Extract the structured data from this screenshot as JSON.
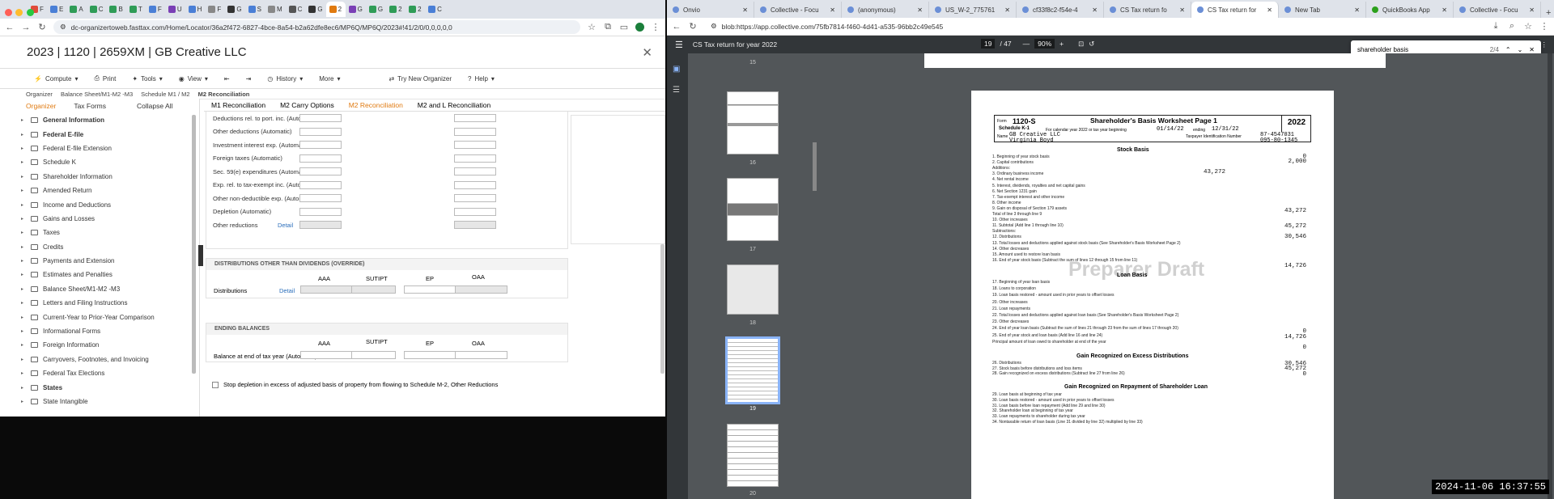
{
  "left_browser": {
    "tabs": [
      {
        "label": "F"
      },
      {
        "label": "E"
      },
      {
        "label": "A"
      },
      {
        "label": "C"
      },
      {
        "label": "B"
      },
      {
        "label": "T"
      },
      {
        "label": "F"
      },
      {
        "label": "U"
      },
      {
        "label": "H"
      },
      {
        "label": "F"
      },
      {
        "label": "G"
      },
      {
        "label": "S"
      },
      {
        "label": "M"
      },
      {
        "label": "C"
      },
      {
        "label": "G"
      },
      {
        "label": "2"
      },
      {
        "label": "G"
      },
      {
        "label": "G"
      },
      {
        "label": "2"
      },
      {
        "label": "2"
      },
      {
        "label": "C"
      }
    ],
    "url": "dc-organizertoweb.fasttax.com/Home/Locator/36a2f472-6827-4bce-8a54-b2a62dfe8ec6/MP6Q/MP6Q/2023#!41/2/0/0,0,0,0,0",
    "app_title": "2023 | 1120 | 2659XM | GB Creative LLC",
    "toolbar": {
      "compute": "Compute",
      "print": "Print",
      "tools": "Tools",
      "view": "View",
      "history": "History",
      "more": "More",
      "try_new": "Try New Organizer",
      "help": "Help"
    },
    "breadcrumbs": [
      "Organizer",
      "Balance Sheet/M1-M2 -M3",
      "Schedule M1 / M2",
      "M2 Reconciliation"
    ],
    "sidebar": {
      "organizer_tab": "Organizer",
      "tax_forms_tab": "Tax Forms",
      "collapse": "Collapse All",
      "items": [
        {
          "label": "General Information",
          "bold": true
        },
        {
          "label": "Federal E-file",
          "bold": true
        },
        {
          "label": "Federal E-file Extension"
        },
        {
          "label": "Schedule K"
        },
        {
          "label": "Shareholder Information"
        },
        {
          "label": "Amended Return"
        },
        {
          "label": "Income and Deductions"
        },
        {
          "label": "Gains and Losses"
        },
        {
          "label": "Taxes"
        },
        {
          "label": "Credits"
        },
        {
          "label": "Payments and Extension"
        },
        {
          "label": "Estimates and Penalties"
        },
        {
          "label": "Balance Sheet/M1-M2 -M3"
        },
        {
          "label": "Letters and Filing Instructions"
        },
        {
          "label": "Current-Year to Prior-Year Comparison"
        },
        {
          "label": "Informational Forms"
        },
        {
          "label": "Foreign Information"
        },
        {
          "label": "Carryovers, Footnotes, and Invoicing"
        },
        {
          "label": "Federal Tax Elections"
        },
        {
          "label": "States",
          "bold": true
        },
        {
          "label": "State Intangible"
        }
      ]
    },
    "form_tabs": [
      "M1 Reconciliation",
      "M2 Carry Options",
      "M2 Reconciliation",
      "M2 and L Reconciliation"
    ],
    "reductions": [
      "Deductions rel. to port. inc. (Automatic)",
      "Other deductions (Automatic)",
      "Investment interest exp. (Automatic)",
      "Foreign taxes (Automatic)",
      "Sec. 59(e) expenditures (Automatic)",
      "Exp. rel. to tax-exempt inc. (Automatic)",
      "Other non-deductible exp. (Automatic)",
      "Depletion (Automatic)",
      "Other reductions"
    ],
    "detail": "Detail",
    "dist_section": {
      "title": "DISTRIBUTIONS OTHER THAN DIVIDENDS (OVERRIDE)",
      "cols": [
        "AAA",
        "SUTIPT",
        "EP",
        "OAA"
      ],
      "row": "Distributions",
      "detail": "Detail"
    },
    "ending_section": {
      "title": "ENDING BALANCES",
      "cols": [
        "AAA",
        "SUTIPT",
        "EP",
        "OAA"
      ],
      "row": "Balance at end of tax year (Automatic)"
    },
    "checkbox": "Stop depletion in excess of adjusted basis of property from flowing to Schedule M-2, Other Reductions"
  },
  "right_browser": {
    "tabs": [
      {
        "label": "Onvio"
      },
      {
        "label": "Collective - Focu"
      },
      {
        "label": "(anonymous)"
      },
      {
        "label": "US_W-2_775761"
      },
      {
        "label": "cf33f8c2-f54e-4"
      },
      {
        "label": "CS Tax return fo"
      },
      {
        "label": "CS Tax return for"
      },
      {
        "label": "New Tab"
      },
      {
        "label": "QuickBooks App"
      },
      {
        "label": "Collective - Focu"
      }
    ],
    "url": "blob:https://app.collective.com/75fb7814-f460-4d41-a535-96bb2c49e545",
    "pdf_title": "CS Tax return for year 2022",
    "page": "19",
    "pages": "/ 47",
    "zoom": "90%",
    "search": {
      "query": "shareholder basis",
      "count": "2/4"
    },
    "thumb_labels": [
      "15",
      "16",
      "17",
      "18",
      "19",
      "20"
    ],
    "worksheet": {
      "header": "Shareholder's Basis Worksheet Page 1",
      "form": "1120-S",
      "year": "2022",
      "schedule": "Schedule K-1",
      "period_text": "For calendar year 2022 or tax year beginning",
      "begin": "01/14/22",
      "ending_label": "ending",
      "end": "12/31/22",
      "name_label": "Name",
      "company": "GB Creative LLC",
      "person": "Virginia Boyd",
      "tin_label": "Taxpayer Identification Number",
      "tin1": "87-4547031",
      "tin2": "095-80-1345",
      "stock_title": "Stock Basis",
      "loan_title": "Loan Basis",
      "gain_excess_title": "Gain Recognized on Excess Distributions",
      "gain_repay_title": "Gain Recognized on Repayment of Shareholder Loan",
      "watermark": "Preparer Draft",
      "lines": [
        "1. Beginning of year stock basis",
        "2. Capital contributions",
        "Additions:",
        "3. Ordinary business income",
        "4. Net rental income",
        "5. Interest, dividends, royalties and net capital gains",
        "6. Net Section 1231 gain",
        "7. Tax-exempt interest and other income",
        "8. Other income",
        "9. Gain on disposal of Section 179 assets",
        "Total of line 3 through line 9",
        "10. Other increases",
        "11. Subtotal (Add line 1 through line 10)",
        "Subtractions:",
        "12. Distributions",
        "13. Total losses and deductions applied against stock basis (See Shareholder's Basis Worksheet Page 2)",
        "14. Other decreases",
        "15. Amount used to restore loan basis",
        "16. End of year stock basis (Subtract the sum of lines 12 through 15 from line 11)"
      ],
      "loan_lines": [
        "17. Beginning of year loan basis",
        "18. Loans to corporation",
        "19. Loan basis restored - amount used in prior years to offset losses",
        "20. Other increases",
        "21. Loan repayments",
        "22. Total losses and deductions applied against loan basis (See Shareholder's Basis Worksheet Page 2)",
        "23. Other decreases",
        "24. End of year loan basis (Subtract the sum of lines 21 through 23 from the sum of lines 17 through 20)",
        "25. End of year stock and loan basis (Add line 16 and line 24)",
        "Principal amount of loan owed to shareholder at end of the year"
      ],
      "gain_lines": [
        "26. Distributions",
        "27. Stock basis before distributions and loss items",
        "28. Gain recognized on excess distributions (Subtract line 27 from line 26)"
      ],
      "repay_lines": [
        "29. Loan basis at beginning of tax year",
        "30. Loan basis restored - amount used in prior years to offset losses",
        "31. Loan basis before loan repayment (Add line 29 and line 30)",
        "32. Shareholder loan at beginning of tax year",
        "33. Loan repayments to shareholder during tax year",
        "34. Nontaxable return of loan basis (Line 31 divided by line 32) multiplied by line 33)"
      ],
      "values": {
        "v1": "0",
        "v2": "2,000",
        "v3": "43,272",
        "vtot": "43,272",
        "v11": "45,272",
        "v12": "30,546",
        "v16": "14,726",
        "v24": "0",
        "v25": "14,726",
        "vp": "0",
        "v26": "30,546",
        "v27": "45,272",
        "v28": "0"
      }
    }
  },
  "timestamp": "2024-11-06 16:37:55"
}
